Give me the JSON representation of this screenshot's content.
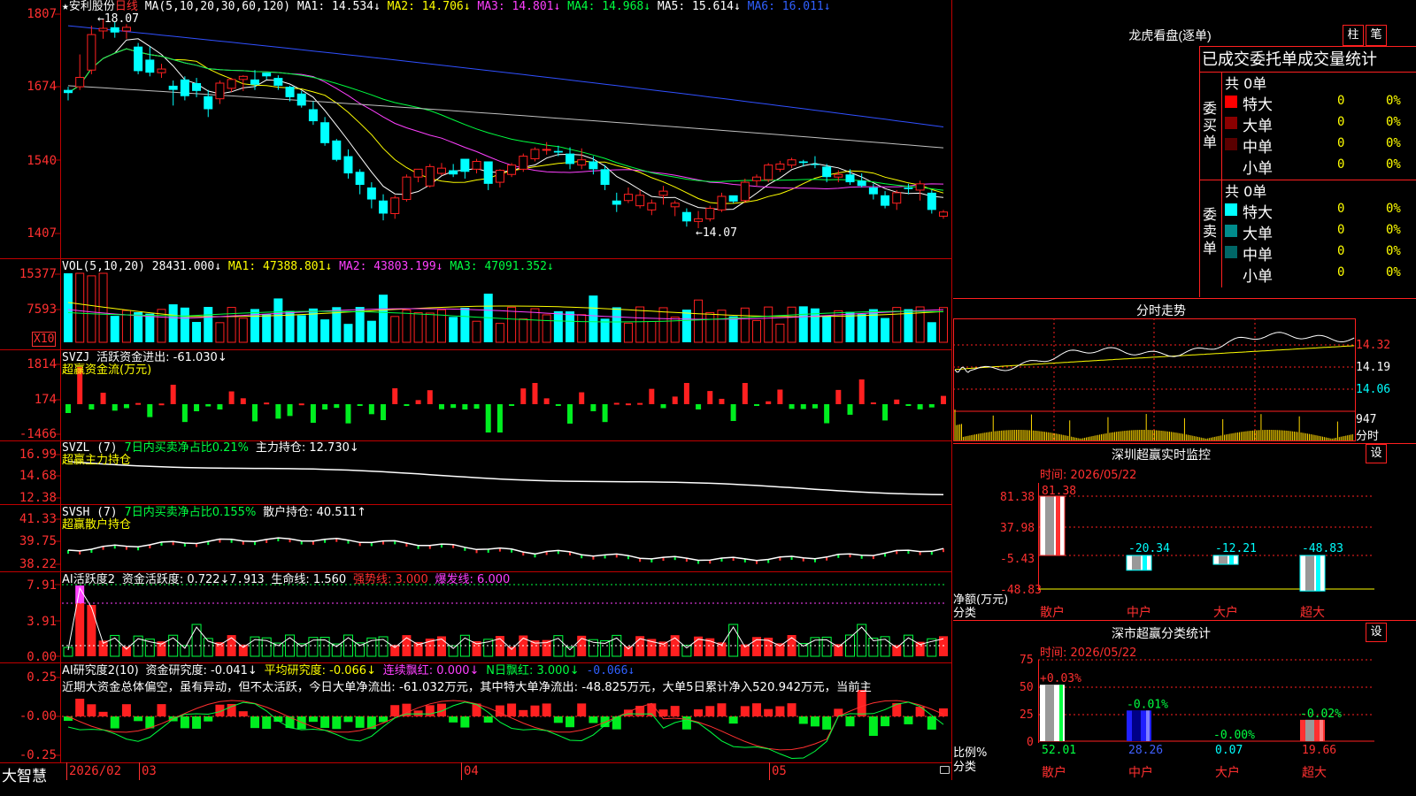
{
  "chart_header": {
    "star": "★",
    "stock_name": "安利股份",
    "period": "日线",
    "ma_label": "MA(5,10,20,30,60,120)",
    "ma1": "MA1: 14.534↓",
    "ma2": "MA2: 14.706↓",
    "ma3": "MA3: 14.801↓",
    "ma4": "MA4: 14.968↓",
    "ma5": "MA5: 15.614↓",
    "ma6": "MA6: 16.011↓",
    "high_marker": "←18.07",
    "low_marker": "←14.07"
  },
  "colors": {
    "up": "#ff2020",
    "down": "#00ffff",
    "ma1": "#ffffff",
    "ma2": "#ffff00",
    "ma3": "#ff40ff",
    "ma4": "#00ff40",
    "ma5": "#3050ff",
    "ma6": "#c0c0c0",
    "grid": "#ff2020"
  },
  "price_axis": [
    "1807",
    "1674",
    "1540",
    "1407"
  ],
  "vol": {
    "label": "VOL(5,10,20)",
    "value": "28431.000↓",
    "ma1": "MA1: 47388.801↓",
    "ma2": "MA2: 43803.199↓",
    "ma3": "MA3: 47091.352↓",
    "axis": [
      "15377",
      "7593"
    ],
    "unit": "X10"
  },
  "svzj": {
    "label": "SVZJ",
    "text": "活跃资金进出: -61.030↓",
    "sub": "超赢资金流(万元)",
    "axis": [
      "1814",
      "174",
      "-1466"
    ]
  },
  "svzl": {
    "label": "SVZL (7)",
    "text1": "7日内买卖净占比0.21%",
    "text2": "主力持仓: 12.730↓",
    "sub": "超赢主力持仓",
    "axis": [
      "16.99",
      "14.68",
      "12.38"
    ]
  },
  "svsh": {
    "label": "SVSH (7)",
    "text1": "7日内买卖净占比0.155%",
    "text2": "散户持仓: 40.511↑",
    "sub": "超赢散户持仓",
    "axis": [
      "41.33",
      "39.75",
      "38.22"
    ]
  },
  "ai1": {
    "label": "AI活跃度2",
    "text1": "资金活跃度: 0.722↓",
    "text2": "7.913",
    "text3": "生命线: 1.560",
    "text4": "强势线: 3.000",
    "text5": "爆发线: 6.000",
    "axis": [
      "7.91",
      "3.91",
      "0.00"
    ]
  },
  "ai2": {
    "label": "AI研究度2(10)",
    "text1": "资金研究度: -0.041↓",
    "text2": "平均研究度: -0.066↓",
    "text3": "连续飘红: 0.000↓",
    "text4": "N日飘红: 3.000↓",
    "text5": "-0.066↓",
    "note": "近期大资金总体偏空，虽有异动，但不太活跃，今日大单净流出: -61.032万元，其中特大单净流出: -48.825万元，大单5日累计净入520.942万元，当前主",
    "axis": [
      "0.25",
      "-0.00",
      "-0.25"
    ]
  },
  "xaxis": {
    "brand": "大智慧",
    "labels": [
      "2026/02",
      "03",
      "04",
      "05"
    ]
  },
  "right": {
    "title": "龙虎看盘(逐单)",
    "btn_bar": "柱",
    "btn_pen": "笔",
    "subtitle": "已成交委托单成交量统计",
    "buy_label": "委买单",
    "sell_label": "委卖单",
    "buy_total": "共 0单",
    "sell_total": "共 0单",
    "buy_rows": [
      {
        "name": "特大",
        "val": "0",
        "pct": "0%"
      },
      {
        "name": "大单",
        "val": "0",
        "pct": "0%"
      },
      {
        "name": "中单",
        "val": "0",
        "pct": "0%"
      },
      {
        "name": "小单",
        "val": "0",
        "pct": "0%"
      }
    ],
    "sell_rows": [
      {
        "name": "特大",
        "val": "0",
        "pct": "0%"
      },
      {
        "name": "大单",
        "val": "0",
        "pct": "0%"
      },
      {
        "name": "中单",
        "val": "0",
        "pct": "0%"
      },
      {
        "name": "小单",
        "val": "0",
        "pct": "0%"
      }
    ],
    "intraday_title": "分时走势",
    "intraday_axis": [
      "14.32",
      "14.19",
      "14.06",
      "947",
      "分时"
    ],
    "monitor_title": "深圳超赢实时监控",
    "set_btn": "设",
    "monitor_time": "时间: 2026/05/22",
    "monitor_axis": [
      "81.38",
      "37.98",
      "-5.43",
      "-48.83"
    ],
    "monitor_unit": "净额(万元)",
    "monitor_cat": "分类",
    "monitor_values": [
      "81.38",
      "-20.34",
      "-12.21",
      "-48.83"
    ],
    "categories": [
      "散户",
      "中户",
      "大户",
      "超大"
    ],
    "class_title": "深市超赢分类统计",
    "class_time": "时间: 2026/05/22",
    "class_axis": [
      "75",
      "50",
      "25",
      "0"
    ],
    "class_unit": "比例%",
    "class_cat": "分类",
    "class_changes": [
      "+0.03%",
      "-0.01%",
      "-0.00%",
      "-0.02%"
    ],
    "class_values": [
      "52.01",
      "28.26",
      "0.07",
      "19.66"
    ]
  },
  "chart_data": {
    "type": "candlestick",
    "title": "安利股份 日线",
    "ohlc": [
      [
        16.72,
        16.78,
        16.52,
        16.66
      ],
      [
        16.78,
        17.4,
        16.72,
        16.96
      ],
      [
        17.1,
        17.95,
        17.02,
        17.78
      ],
      [
        17.85,
        18.07,
        17.7,
        17.9
      ],
      [
        17.92,
        18.02,
        17.72,
        17.82
      ],
      [
        17.85,
        17.98,
        17.7,
        17.92
      ],
      [
        17.55,
        17.62,
        17.02,
        17.08
      ],
      [
        17.3,
        17.55,
        16.98,
        17.05
      ],
      [
        17.05,
        17.22,
        16.95,
        17.12
      ],
      [
        16.8,
        16.9,
        16.42,
        16.72
      ],
      [
        16.92,
        16.98,
        16.52,
        16.6
      ],
      [
        16.85,
        16.95,
        16.58,
        16.7
      ],
      [
        16.6,
        16.72,
        16.2,
        16.35
      ],
      [
        16.55,
        16.9,
        16.45,
        16.85
      ],
      [
        16.75,
        16.95,
        16.68,
        16.92
      ],
      [
        16.92,
        17.0,
        16.7,
        16.98
      ],
      [
        16.92,
        17.1,
        16.72,
        16.82
      ],
      [
        17.05,
        17.05,
        16.92,
        16.98
      ],
      [
        16.95,
        17.0,
        16.72,
        16.8
      ],
      [
        16.78,
        16.8,
        16.5,
        16.58
      ],
      [
        16.65,
        16.7,
        16.38,
        16.42
      ],
      [
        16.35,
        16.5,
        16.05,
        16.12
      ],
      [
        16.1,
        16.2,
        15.65,
        15.7
      ],
      [
        15.75,
        15.78,
        15.35,
        15.38
      ],
      [
        15.45,
        15.58,
        15.02,
        15.12
      ],
      [
        15.15,
        15.2,
        14.72,
        14.9
      ],
      [
        14.85,
        14.95,
        14.45,
        14.62
      ],
      [
        14.6,
        14.72,
        14.22,
        14.35
      ],
      [
        14.35,
        14.7,
        14.25,
        14.65
      ],
      [
        14.62,
        15.1,
        14.58,
        15.05
      ],
      [
        15.05,
        15.18,
        14.95,
        15.2
      ],
      [
        14.88,
        15.3,
        14.85,
        15.25
      ],
      [
        15.12,
        15.32,
        15.08,
        15.22
      ],
      [
        15.18,
        15.3,
        15.05,
        15.1
      ],
      [
        15.4,
        15.25,
        15.02,
        15.15
      ],
      [
        15.2,
        15.4,
        15.12,
        15.35
      ],
      [
        15.35,
        15.25,
        14.8,
        14.92
      ],
      [
        14.95,
        15.2,
        14.85,
        15.18
      ],
      [
        15.1,
        15.32,
        15.05,
        15.28
      ],
      [
        15.2,
        15.5,
        15.15,
        15.45
      ],
      [
        15.4,
        15.62,
        15.35,
        15.58
      ],
      [
        15.58,
        15.72,
        15.48,
        15.58
      ],
      [
        15.55,
        15.65,
        15.45,
        15.52
      ],
      [
        15.5,
        15.62,
        15.2,
        15.3
      ],
      [
        15.28,
        15.6,
        15.2,
        15.38
      ],
      [
        15.35,
        15.45,
        15.1,
        15.2
      ],
      [
        15.2,
        15.28,
        14.8,
        14.9
      ],
      [
        14.6,
        14.75,
        14.38,
        14.52
      ],
      [
        14.6,
        14.85,
        14.55,
        14.72
      ],
      [
        14.5,
        14.8,
        14.45,
        14.7
      ],
      [
        14.42,
        14.62,
        14.32,
        14.55
      ],
      [
        14.7,
        14.88,
        14.52,
        14.78
      ],
      [
        14.48,
        14.6,
        14.3,
        14.55
      ],
      [
        14.38,
        14.45,
        14.1,
        14.2
      ],
      [
        14.2,
        14.4,
        14.07,
        14.25
      ],
      [
        14.25,
        14.5,
        14.2,
        14.45
      ],
      [
        14.42,
        14.75,
        14.38,
        14.68
      ],
      [
        14.7,
        14.65,
        14.55,
        14.58
      ],
      [
        14.6,
        15.02,
        14.55,
        14.95
      ],
      [
        14.98,
        15.1,
        14.88,
        15.05
      ],
      [
        15.0,
        15.32,
        14.95,
        15.28
      ],
      [
        15.2,
        15.36,
        15.15,
        15.3
      ],
      [
        15.28,
        15.42,
        15.22,
        15.38
      ],
      [
        15.35,
        15.38,
        15.25,
        15.32
      ],
      [
        15.3,
        15.45,
        15.22,
        15.28
      ],
      [
        15.25,
        15.3,
        14.95,
        15.05
      ],
      [
        15.05,
        15.18,
        14.95,
        15.1
      ],
      [
        15.1,
        15.2,
        14.9,
        14.95
      ],
      [
        14.98,
        15.12,
        14.85,
        14.88
      ],
      [
        14.85,
        14.92,
        14.62,
        14.72
      ],
      [
        14.7,
        14.78,
        14.45,
        14.5
      ],
      [
        14.55,
        14.8,
        14.42,
        14.75
      ],
      [
        14.85,
        14.92,
        14.72,
        14.82
      ],
      [
        14.8,
        14.98,
        14.6,
        14.92
      ],
      [
        14.75,
        14.8,
        14.35,
        14.42
      ],
      [
        14.3,
        14.42,
        14.25,
        14.38
      ]
    ],
    "price_range": [
      14.07,
      18.07
    ],
    "x_labels": [
      "2026/02",
      "03",
      "04",
      "05"
    ]
  }
}
